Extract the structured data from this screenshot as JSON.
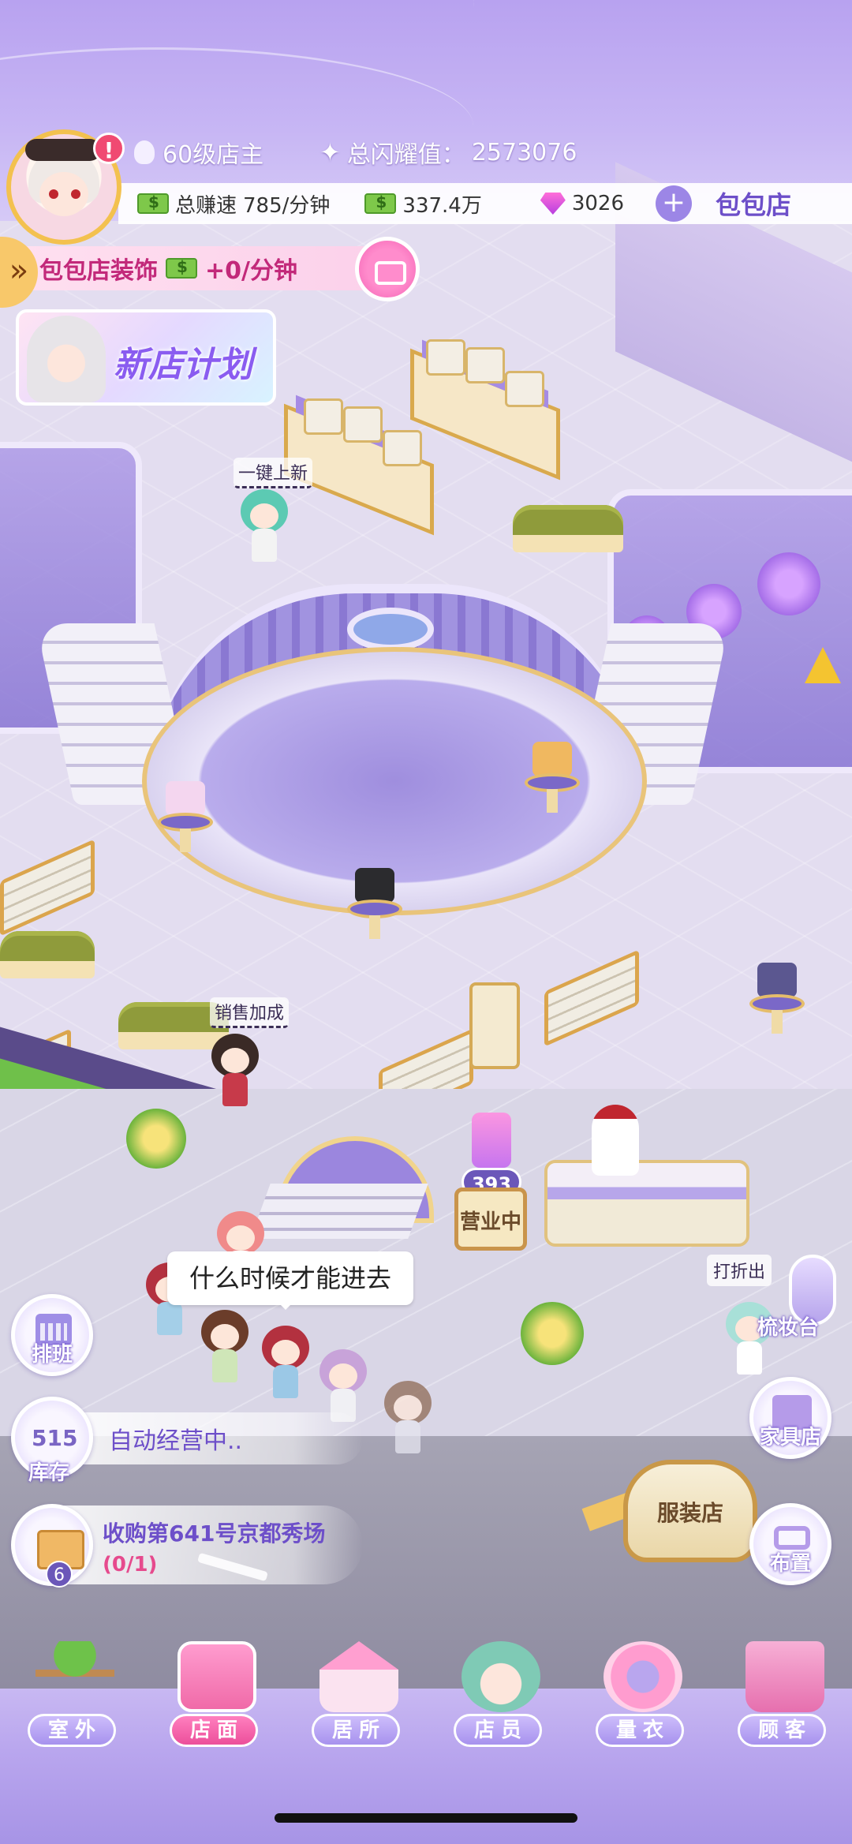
{
  "player": {
    "level": "60级店主",
    "shine_label": "总闪耀值：",
    "shine_value": "2573076",
    "alert": "!"
  },
  "resources": {
    "earn_rate_label": "总赚速",
    "earn_rate_value": "785/分钟",
    "cash": "337.4万",
    "gems": "3026",
    "plus": "+",
    "shop_name": "包包店"
  },
  "decoration": {
    "expand": "»",
    "label": "包包店装饰",
    "bonus": "+0/分钟"
  },
  "event": {
    "title": "新店计划"
  },
  "scene": {
    "label_restock": "一键上新",
    "label_sales_bonus": "销售加成",
    "queue_count": "393",
    "open_sign": "营业中",
    "speech": "什么时候才能进去",
    "label_discount": "打折出",
    "dresser": "梳妆台",
    "fashion_sign": "服装店"
  },
  "left_panel": {
    "schedule_label": "排班",
    "stock_value": "515",
    "stock_label": "库存",
    "auto_status": "自动经营中..",
    "acquire_title": "收购第641号京都秀场",
    "acquire_progress": "(0/1)",
    "acquire_badge": "6"
  },
  "right_panel": {
    "furniture_store": "家具店",
    "arrange": "布置"
  },
  "bottom_nav": [
    {
      "label": "室外"
    },
    {
      "label": "店面"
    },
    {
      "label": "居所"
    },
    {
      "label": "店员"
    },
    {
      "label": "量衣"
    },
    {
      "label": "顾客"
    }
  ],
  "colors": {
    "accent": "#6d4fc9",
    "active_tab": "#ec4f9b",
    "nav_bg": "#b9a6ee"
  }
}
